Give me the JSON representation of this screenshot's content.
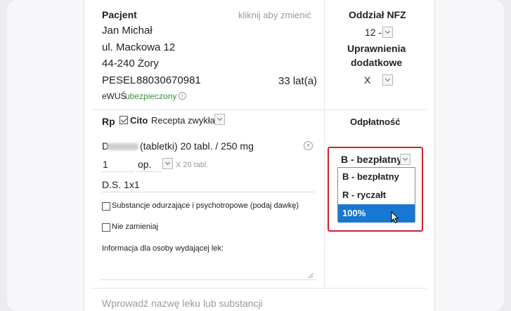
{
  "patient": {
    "heading": "Pacjent",
    "change_hint": "kliknij aby zmienić",
    "name": "Jan Michał",
    "street": "ul. Mackowa 12",
    "city": "44-240 Żory",
    "pesel_label": "PESEL",
    "pesel": "88030670981",
    "age": "33 lat(a)",
    "ewus_label": "eWUŚ",
    "ewus_status": "ubezpieczony"
  },
  "nfz": {
    "heading": "Oddział NFZ",
    "value": "12 -",
    "permissions_line1": "Uprawnienia",
    "permissions_line2": "dodatkowe",
    "permissions_value": "X"
  },
  "prescription": {
    "rp_label": "Rp",
    "cito_label": "Cito",
    "cito_checked": true,
    "type_value": "Recepta zwykła",
    "drug_prefix": "D",
    "drug_rest": "(tabletki) 20 tabl. / 250 mg",
    "quantity": "1",
    "unit": "op.",
    "unit_hint": "X 20 tabl.",
    "ds": "D.S. 1x1",
    "opt_substances": "Substancje odurzające i psychotropowe (podaj dawkę)",
    "opt_no_substitute": "Nie zamieniaj",
    "dispenser_info_label": "Informacja dla osoby wydającej lek:",
    "search_placeholder": "Wprowadź nazwę leku lub substancji"
  },
  "payment": {
    "heading": "Odpłatność",
    "selected": "B - bezpłatny",
    "options": [
      "B - bezpłatny",
      "R - ryczałt",
      "100%"
    ],
    "highlighted_option": "100%",
    "highlight_color": "#d4212a",
    "selection_color": "#1877d2"
  }
}
